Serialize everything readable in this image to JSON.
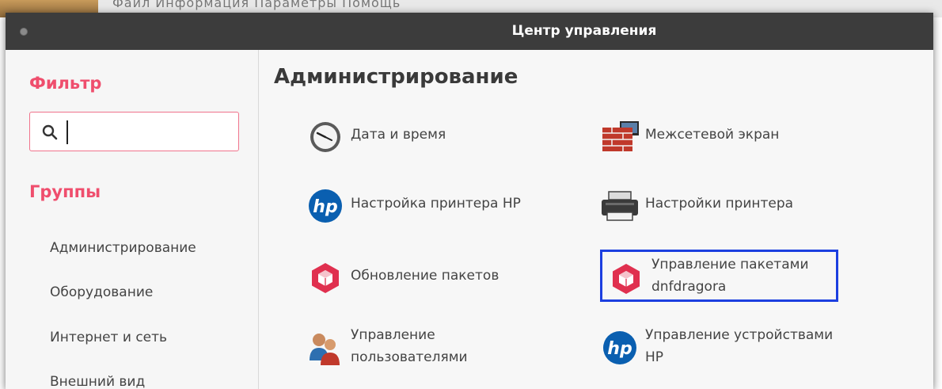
{
  "background_window": {
    "menu_text": "Файл  Информация  Параметры  Помощь"
  },
  "window": {
    "title": "Центр управления"
  },
  "sidebar": {
    "filter_heading": "Фильтр",
    "search": {
      "value": "",
      "placeholder": ""
    },
    "groups_heading": "Группы",
    "groups": [
      {
        "label": "Администрирование"
      },
      {
        "label": "Оборудование"
      },
      {
        "label": "Интернет и сеть"
      },
      {
        "label": "Внешний вид"
      }
    ]
  },
  "main": {
    "section_title": "Администрирование",
    "tools": [
      {
        "label_line1": "Дата и время",
        "label_line2": "",
        "icon": "clock-icon"
      },
      {
        "label_line1": "Межсетевой экран",
        "label_line2": "",
        "icon": "firewall-icon"
      },
      {
        "label_line1": "Настройка принтера HP",
        "label_line2": "",
        "icon": "hp-logo-icon"
      },
      {
        "label_line1": "Настройки принтера",
        "label_line2": "",
        "icon": "printer-icon"
      },
      {
        "label_line1": "Обновление пакетов",
        "label_line2": "",
        "icon": "package-icon"
      },
      {
        "label_line1": "Управление пакетами",
        "label_line2": "dnfdragora",
        "icon": "package-icon",
        "selected": true
      },
      {
        "label_line1": "Управление",
        "label_line2": "пользователями",
        "icon": "users-icon"
      },
      {
        "label_line1": "Управление устройствами",
        "label_line2": "HP",
        "icon": "hp-logo-icon"
      }
    ]
  },
  "colors": {
    "accent": "#ef4e6d",
    "selection": "#1c3fe0",
    "titlebar": "#3c3c3c"
  }
}
